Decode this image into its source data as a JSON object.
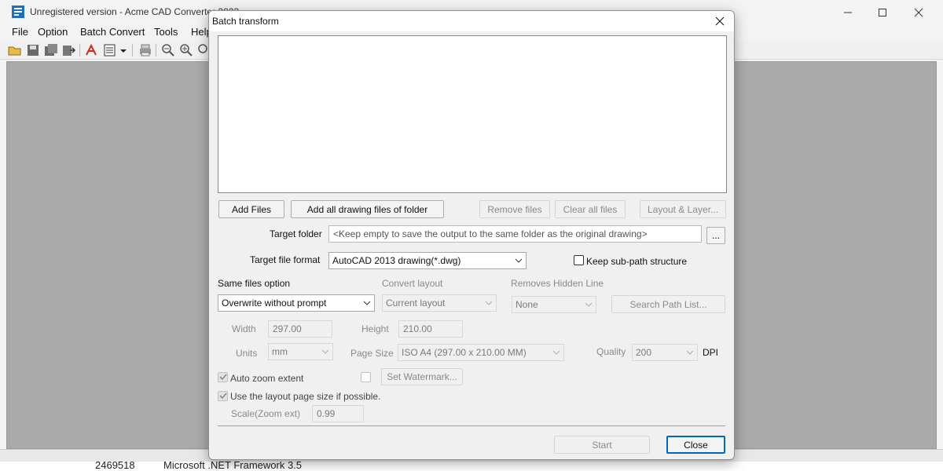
{
  "app": {
    "title": "Unregistered version - Acme CAD Converter 2023",
    "menu": [
      "File",
      "Option",
      "Batch Convert",
      "Tools",
      "Help"
    ],
    "bottom_row": [
      "2469518",
      "Microsoft .NET Framework 3.5"
    ]
  },
  "dialog": {
    "title": "Batch transform",
    "buttons": {
      "add_files": "Add Files",
      "add_folder": "Add all drawing files of folder",
      "remove_files": "Remove files",
      "clear_files": "Clear all files",
      "layout_layer": "Layout & Layer...",
      "browse": "...",
      "search_path": "Search Path List...",
      "set_watermark": "Set Watermark...",
      "start": "Start",
      "close": "Close"
    },
    "target_folder": {
      "label": "Target folder",
      "placeholder": "<Keep empty to save the output to the same folder as the original drawing>"
    },
    "target_format": {
      "label": "Target file format",
      "value": "AutoCAD 2013 drawing(*.dwg)"
    },
    "keep_subpath": {
      "label": "Keep sub-path structure",
      "checked": false
    },
    "same_files": {
      "label": "Same files option",
      "value": "Overwrite without prompt"
    },
    "convert_layout": {
      "label": "Convert layout",
      "value": "Current layout"
    },
    "hidden_line": {
      "label": "Removes Hidden Line",
      "value": "None"
    },
    "width": {
      "label": "Width",
      "value": "297.00"
    },
    "height": {
      "label": "Height",
      "value": "210.00"
    },
    "units": {
      "label": "Units",
      "value": "mm"
    },
    "page_size": {
      "label": "Page Size",
      "value": "ISO A4 (297.00 x 210.00 MM)"
    },
    "quality": {
      "label": "Quality",
      "value": "200",
      "unit": "DPI"
    },
    "auto_zoom": {
      "label": "Auto zoom extent",
      "checked": true
    },
    "watermark_check": {
      "checked": false
    },
    "layout_page_size": {
      "label": "Use the layout page size if possible.",
      "checked": true
    },
    "scale": {
      "label": "Scale(Zoom ext)",
      "value": "0.99"
    }
  },
  "colors": {
    "accent": "#0067c0",
    "workspace": "#aaaaaa",
    "dialog_bg": "#f0f0f0"
  }
}
